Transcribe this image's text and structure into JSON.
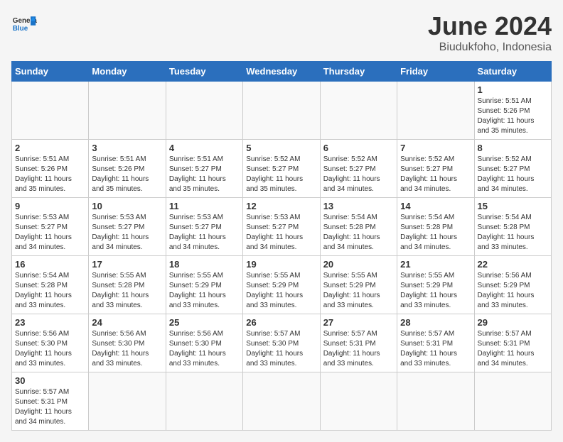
{
  "header": {
    "logo_general": "General",
    "logo_blue": "Blue",
    "title": "June 2024",
    "subtitle": "Biudukfoho, Indonesia"
  },
  "weekdays": [
    "Sunday",
    "Monday",
    "Tuesday",
    "Wednesday",
    "Thursday",
    "Friday",
    "Saturday"
  ],
  "weeks": [
    [
      {
        "day": "",
        "info": ""
      },
      {
        "day": "",
        "info": ""
      },
      {
        "day": "",
        "info": ""
      },
      {
        "day": "",
        "info": ""
      },
      {
        "day": "",
        "info": ""
      },
      {
        "day": "",
        "info": ""
      },
      {
        "day": "1",
        "info": "Sunrise: 5:51 AM\nSunset: 5:26 PM\nDaylight: 11 hours\nand 35 minutes."
      }
    ],
    [
      {
        "day": "2",
        "info": "Sunrise: 5:51 AM\nSunset: 5:26 PM\nDaylight: 11 hours\nand 35 minutes."
      },
      {
        "day": "3",
        "info": "Sunrise: 5:51 AM\nSunset: 5:26 PM\nDaylight: 11 hours\nand 35 minutes."
      },
      {
        "day": "4",
        "info": "Sunrise: 5:51 AM\nSunset: 5:27 PM\nDaylight: 11 hours\nand 35 minutes."
      },
      {
        "day": "5",
        "info": "Sunrise: 5:52 AM\nSunset: 5:27 PM\nDaylight: 11 hours\nand 35 minutes."
      },
      {
        "day": "6",
        "info": "Sunrise: 5:52 AM\nSunset: 5:27 PM\nDaylight: 11 hours\nand 34 minutes."
      },
      {
        "day": "7",
        "info": "Sunrise: 5:52 AM\nSunset: 5:27 PM\nDaylight: 11 hours\nand 34 minutes."
      },
      {
        "day": "8",
        "info": "Sunrise: 5:52 AM\nSunset: 5:27 PM\nDaylight: 11 hours\nand 34 minutes."
      }
    ],
    [
      {
        "day": "9",
        "info": "Sunrise: 5:53 AM\nSunset: 5:27 PM\nDaylight: 11 hours\nand 34 minutes."
      },
      {
        "day": "10",
        "info": "Sunrise: 5:53 AM\nSunset: 5:27 PM\nDaylight: 11 hours\nand 34 minutes."
      },
      {
        "day": "11",
        "info": "Sunrise: 5:53 AM\nSunset: 5:27 PM\nDaylight: 11 hours\nand 34 minutes."
      },
      {
        "day": "12",
        "info": "Sunrise: 5:53 AM\nSunset: 5:27 PM\nDaylight: 11 hours\nand 34 minutes."
      },
      {
        "day": "13",
        "info": "Sunrise: 5:54 AM\nSunset: 5:28 PM\nDaylight: 11 hours\nand 34 minutes."
      },
      {
        "day": "14",
        "info": "Sunrise: 5:54 AM\nSunset: 5:28 PM\nDaylight: 11 hours\nand 34 minutes."
      },
      {
        "day": "15",
        "info": "Sunrise: 5:54 AM\nSunset: 5:28 PM\nDaylight: 11 hours\nand 33 minutes."
      }
    ],
    [
      {
        "day": "16",
        "info": "Sunrise: 5:54 AM\nSunset: 5:28 PM\nDaylight: 11 hours\nand 33 minutes."
      },
      {
        "day": "17",
        "info": "Sunrise: 5:55 AM\nSunset: 5:28 PM\nDaylight: 11 hours\nand 33 minutes."
      },
      {
        "day": "18",
        "info": "Sunrise: 5:55 AM\nSunset: 5:29 PM\nDaylight: 11 hours\nand 33 minutes."
      },
      {
        "day": "19",
        "info": "Sunrise: 5:55 AM\nSunset: 5:29 PM\nDaylight: 11 hours\nand 33 minutes."
      },
      {
        "day": "20",
        "info": "Sunrise: 5:55 AM\nSunset: 5:29 PM\nDaylight: 11 hours\nand 33 minutes."
      },
      {
        "day": "21",
        "info": "Sunrise: 5:55 AM\nSunset: 5:29 PM\nDaylight: 11 hours\nand 33 minutes."
      },
      {
        "day": "22",
        "info": "Sunrise: 5:56 AM\nSunset: 5:29 PM\nDaylight: 11 hours\nand 33 minutes."
      }
    ],
    [
      {
        "day": "23",
        "info": "Sunrise: 5:56 AM\nSunset: 5:30 PM\nDaylight: 11 hours\nand 33 minutes."
      },
      {
        "day": "24",
        "info": "Sunrise: 5:56 AM\nSunset: 5:30 PM\nDaylight: 11 hours\nand 33 minutes."
      },
      {
        "day": "25",
        "info": "Sunrise: 5:56 AM\nSunset: 5:30 PM\nDaylight: 11 hours\nand 33 minutes."
      },
      {
        "day": "26",
        "info": "Sunrise: 5:57 AM\nSunset: 5:30 PM\nDaylight: 11 hours\nand 33 minutes."
      },
      {
        "day": "27",
        "info": "Sunrise: 5:57 AM\nSunset: 5:31 PM\nDaylight: 11 hours\nand 33 minutes."
      },
      {
        "day": "28",
        "info": "Sunrise: 5:57 AM\nSunset: 5:31 PM\nDaylight: 11 hours\nand 33 minutes."
      },
      {
        "day": "29",
        "info": "Sunrise: 5:57 AM\nSunset: 5:31 PM\nDaylight: 11 hours\nand 34 minutes."
      }
    ],
    [
      {
        "day": "30",
        "info": "Sunrise: 5:57 AM\nSunset: 5:31 PM\nDaylight: 11 hours\nand 34 minutes."
      },
      {
        "day": "",
        "info": ""
      },
      {
        "day": "",
        "info": ""
      },
      {
        "day": "",
        "info": ""
      },
      {
        "day": "",
        "info": ""
      },
      {
        "day": "",
        "info": ""
      },
      {
        "day": "",
        "info": ""
      }
    ]
  ]
}
